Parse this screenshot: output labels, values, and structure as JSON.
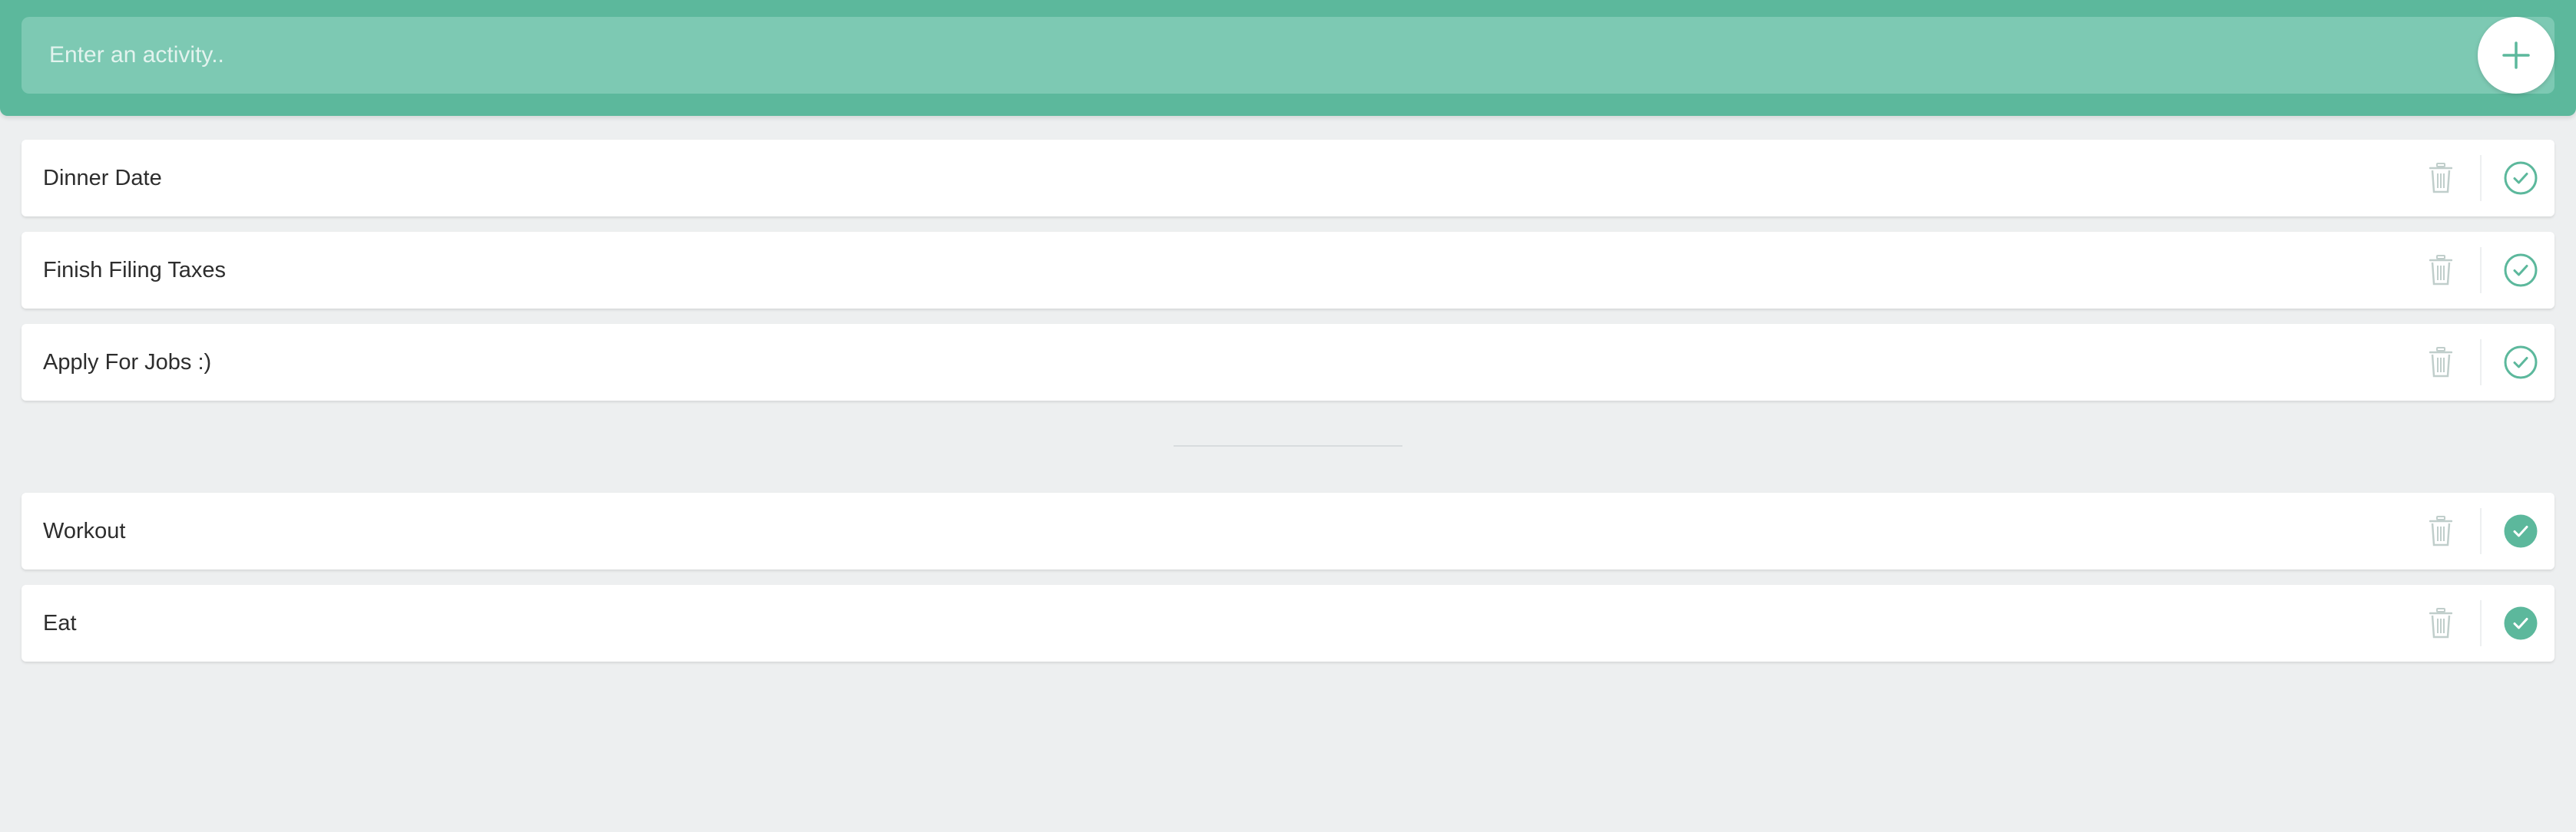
{
  "add_bar": {
    "placeholder": "Enter an activity..",
    "add_icon": "plus-icon"
  },
  "todo": [
    {
      "label": "Dinner Date",
      "completed": false
    },
    {
      "label": "Finish Filing Taxes",
      "completed": false
    },
    {
      "label": "Apply For Jobs :)",
      "completed": false
    }
  ],
  "completed": [
    {
      "label": "Workout",
      "completed": true
    },
    {
      "label": "Eat",
      "completed": true
    }
  ],
  "icons": {
    "remove": "trash-icon",
    "complete": "check-circle-icon"
  },
  "colors": {
    "accent": "#5cb89c",
    "accent_light": "#7dc9b3",
    "background": "#edeff0",
    "trash": "#c0cecb"
  }
}
